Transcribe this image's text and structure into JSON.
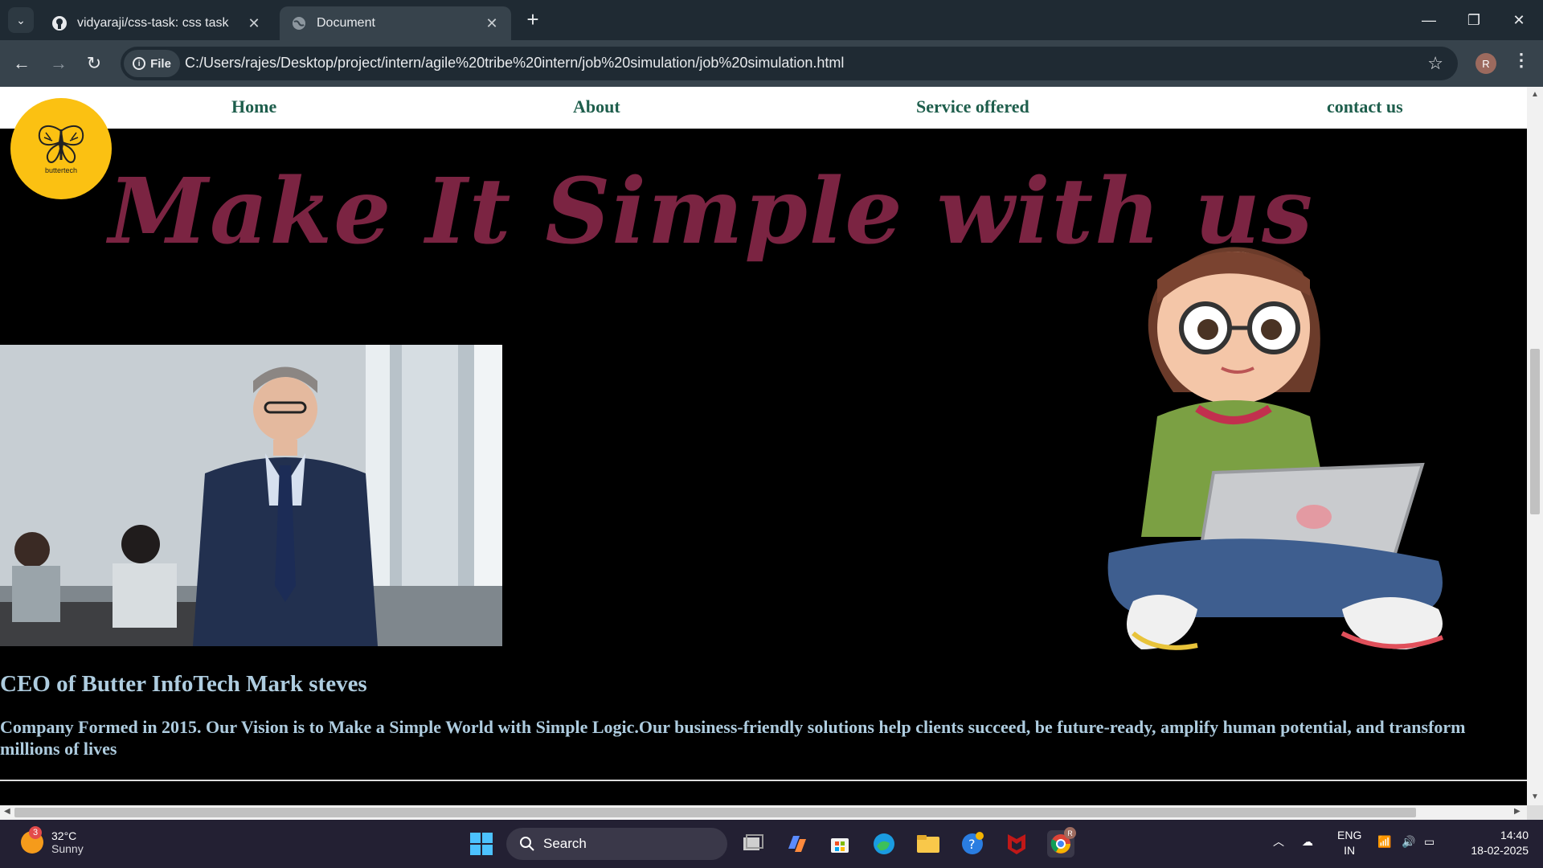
{
  "browser": {
    "tabs": [
      {
        "title": "vidyaraji/css-task: css task",
        "favicon": "github-icon"
      },
      {
        "title": "Document",
        "favicon": "globe-icon"
      }
    ],
    "active_tab": 1,
    "address_chip": "File",
    "url": "C:/Users/rajes/Desktop/project/intern/agile%20tribe%20intern/job%20simulation/job%20simulation.html",
    "profile_initial": "R"
  },
  "page": {
    "nav": [
      "Home",
      "About",
      "Service offered",
      "contact us"
    ],
    "logo_text": "buttertech",
    "hero_title": "Make It Simple with us",
    "ceo_heading": "CEO of Butter InfoTech Mark steves",
    "about_text": "Company Formed in 2015. Our Vision is to Make a Simple World with Simple Logic.Our business-friendly solutions help clients succeed, be future-ready, amplify human potential, and transform millions of lives",
    "colors": {
      "nav_text": "#1e5e4c",
      "hero": "#7b2442",
      "body_text": "#aeccdf",
      "logo_bg": "#fbc112"
    }
  },
  "taskbar": {
    "weather_badge": "3",
    "temperature": "32°C",
    "condition": "Sunny",
    "search_label": "Search",
    "lang_line1": "ENG",
    "lang_line2": "IN",
    "time": "14:40",
    "date": "18-02-2025",
    "chrome_badge": "R"
  }
}
